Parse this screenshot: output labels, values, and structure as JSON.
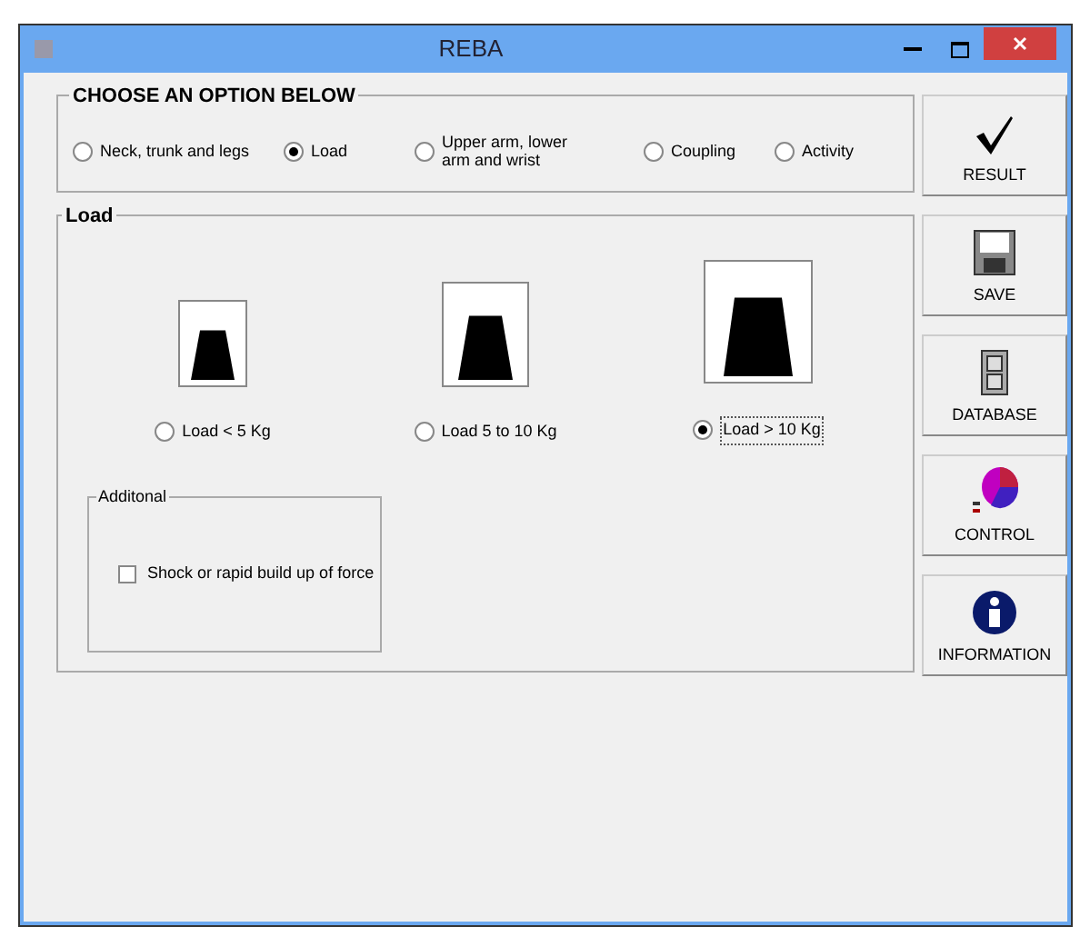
{
  "window": {
    "title": "REBA"
  },
  "options": {
    "title": "CHOOSE AN OPTION BELOW",
    "items": [
      {
        "label": "Neck, trunk and legs",
        "selected": false
      },
      {
        "label": "Load",
        "selected": true
      },
      {
        "label": "Upper arm, lower arm and wrist",
        "selected": false
      },
      {
        "label": "Coupling",
        "selected": false
      },
      {
        "label": "Activity",
        "selected": false
      }
    ]
  },
  "load": {
    "title": "Load",
    "choices": [
      {
        "label": "Load < 5 Kg",
        "selected": false
      },
      {
        "label": "Load 5 to 10 Kg",
        "selected": false
      },
      {
        "label": "Load > 10 Kg",
        "selected": true
      }
    ],
    "additional": {
      "title": "Additonal",
      "checkbox": {
        "label": "Shock or rapid build up of force",
        "checked": false
      }
    }
  },
  "buttons": [
    "RESULT",
    "SAVE",
    "DATABASE",
    "CONTROL",
    "INFORMATION"
  ]
}
